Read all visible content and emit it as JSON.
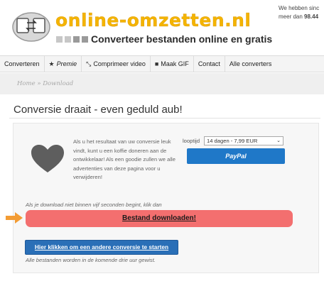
{
  "header": {
    "site_name": "online-omzetten.nl",
    "tagline": "Converteer bestanden online en gratis",
    "corner_line1": "We hebben sinc",
    "corner_line2_prefix": "meer dan ",
    "corner_line2_number": "98.44"
  },
  "nav": {
    "items": [
      {
        "label": "Converteren",
        "icon": ""
      },
      {
        "label": "Premie",
        "icon": "star-icon"
      },
      {
        "label": "Comprimeer video",
        "icon": "compress-icon"
      },
      {
        "label": "Maak GIF",
        "icon": "video-camera-icon"
      },
      {
        "label": "Contact",
        "icon": ""
      },
      {
        "label": "Alle converters",
        "icon": ""
      }
    ]
  },
  "breadcrumb": "Home » Download",
  "main": {
    "title": "Conversie draait - even geduld aub!",
    "support_text": "Als u het resultaat van uw conversie leuk vindt, kunt u een koffie doneren aan de ontwikkelaar! Als een goodie zullen we alle advertenties van deze pagina voor u verwijderen!",
    "runtime_label": "looptijd",
    "runtime_selected": "14 dagen - 7,99 EUR",
    "paypal_label": "PayPal",
    "download_note": "Als je download niet binnen vijf seconden begint, klik dan",
    "download_button": "Bestand downloaden!",
    "restart_button": "Hier klikken om een andere conversie te starten",
    "delete_note": "Alle bestanden worden in de komende drie uur gewist."
  },
  "colors": {
    "brand_yellow": "#f4b400",
    "download_red": "#f36f6f",
    "paypal_blue": "#1f78c8",
    "restart_blue": "#2a6fb7",
    "arrow_orange": "#f39c34"
  }
}
